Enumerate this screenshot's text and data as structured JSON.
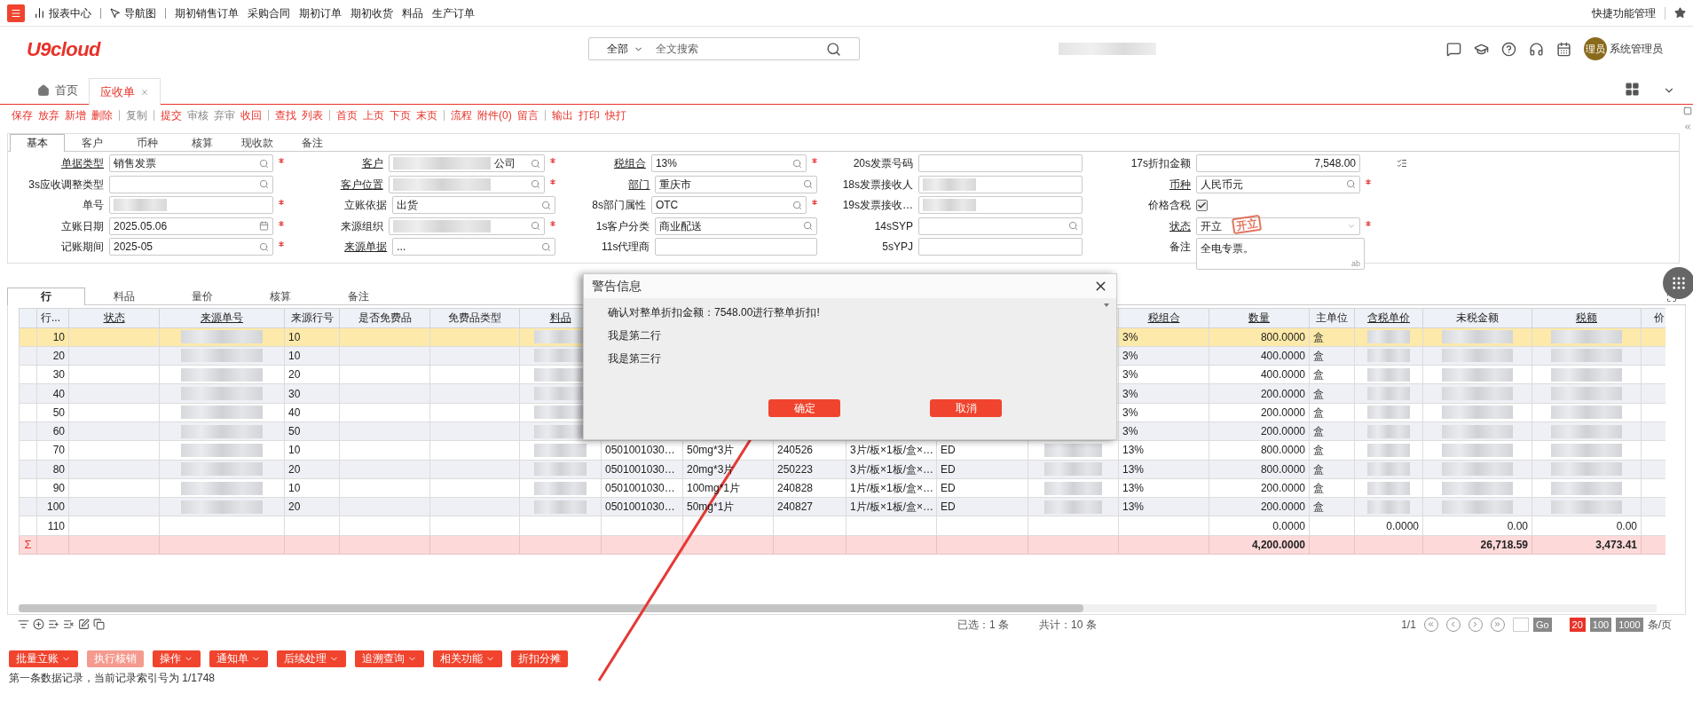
{
  "top_nav": {
    "items": [
      {
        "label": "报表中心",
        "kind": "chart"
      },
      {
        "label": "导航图",
        "kind": "nav"
      },
      {
        "label": "期初销售订单",
        "kind": "plain"
      },
      {
        "label": "采购合同",
        "kind": "plain"
      },
      {
        "label": "期初订单",
        "kind": "plain"
      },
      {
        "label": "期初收货",
        "kind": "plain"
      },
      {
        "label": "料品",
        "kind": "plain"
      },
      {
        "label": "生产订单",
        "kind": "plain"
      }
    ],
    "quick": "快捷功能管理"
  },
  "header": {
    "logo": "U9cloud",
    "search": {
      "scope": "全部",
      "placeholder": "全文搜索"
    },
    "user": {
      "avatar": "理员",
      "name": "系统管理员"
    }
  },
  "page_tabs": [
    {
      "label": "首页",
      "kind": "home",
      "selected": false
    },
    {
      "label": "应收单",
      "kind": "closable",
      "selected": true
    }
  ],
  "toolbar": [
    [
      {
        "label": "保存",
        "disabled": false
      },
      {
        "label": "放弃",
        "disabled": false
      },
      {
        "label": "新增",
        "disabled": false
      },
      {
        "label": "删除",
        "disabled": false
      }
    ],
    [
      {
        "label": "复制",
        "disabled": true
      }
    ],
    [
      {
        "label": "提交",
        "disabled": false
      },
      {
        "label": "审核",
        "disabled": true
      },
      {
        "label": "弃审",
        "disabled": true
      },
      {
        "label": "收回",
        "disabled": false
      }
    ],
    [
      {
        "label": "查找",
        "disabled": false
      },
      {
        "label": "列表",
        "disabled": false
      }
    ],
    [
      {
        "label": "首页",
        "disabled": false
      },
      {
        "label": "上页",
        "disabled": false
      },
      {
        "label": "下页",
        "disabled": false
      },
      {
        "label": "末页",
        "disabled": false
      }
    ],
    [
      {
        "label": "流程",
        "disabled": false
      },
      {
        "label": "附件(0)",
        "disabled": false
      },
      {
        "label": "留言",
        "disabled": false
      }
    ],
    [
      {
        "label": "输出",
        "disabled": false
      },
      {
        "label": "打印",
        "disabled": false
      },
      {
        "label": "快打",
        "disabled": false
      }
    ]
  ],
  "form": {
    "tabs": [
      {
        "label": "基本",
        "selected": true
      },
      {
        "label": "客户",
        "selected": false
      },
      {
        "label": "币种",
        "selected": false
      },
      {
        "label": "核算",
        "selected": false
      },
      {
        "label": "现收款",
        "selected": false
      },
      {
        "label": "备注",
        "selected": false
      }
    ],
    "rows": [
      [
        {
          "label": "单据类型",
          "underlined": true,
          "required": true,
          "kind": "lookup",
          "value": "销售发票"
        },
        {
          "label": "客户",
          "underlined": true,
          "required": true,
          "kind": "lookup",
          "value": "公司",
          "blurred": true
        },
        {
          "label": "税组合",
          "underlined": true,
          "required": true,
          "kind": "lookup",
          "value": "13%"
        },
        {
          "label": "20s发票号码",
          "underlined": false,
          "required": false,
          "kind": "text"
        },
        {
          "label": "17s折扣金额",
          "underlined": false,
          "required": false,
          "kind": "amount",
          "value": "7,548.00"
        }
      ],
      [
        {
          "label": "3s应收调整类型",
          "underlined": false,
          "required": false,
          "kind": "lookup"
        },
        {
          "label": "客户位置",
          "underlined": true,
          "required": true,
          "kind": "lookup",
          "blurred": true
        },
        {
          "label": "部门",
          "underlined": true,
          "required": false,
          "kind": "lookup",
          "value": "重庆市"
        },
        {
          "label": "18s发票接收人",
          "underlined": false,
          "required": false,
          "kind": "text",
          "blurred": true
        },
        {
          "label": "币种",
          "underlined": true,
          "required": true,
          "kind": "lookup",
          "value": "人民币元"
        }
      ],
      [
        {
          "label": "单号",
          "underlined": false,
          "required": true,
          "kind": "text",
          "blurred": true
        },
        {
          "label": "立账依据",
          "underlined": false,
          "required": false,
          "kind": "lookup",
          "value": "出货"
        },
        {
          "label": "8s部门属性",
          "underlined": false,
          "required": true,
          "kind": "lookup",
          "value": "OTC"
        },
        {
          "label": "19s发票接收…",
          "underlined": false,
          "required": false,
          "kind": "text",
          "blurred": true
        },
        {
          "label": "价格含税",
          "underlined": false,
          "required": false,
          "kind": "checkbox",
          "checked": true
        }
      ],
      [
        {
          "label": "立账日期",
          "underlined": false,
          "required": true,
          "kind": "date",
          "value": "2025.05.06"
        },
        {
          "label": "来源组织",
          "underlined": false,
          "required": true,
          "kind": "lookup",
          "blurred": true
        },
        {
          "label": "1s客户分类",
          "underlined": false,
          "required": false,
          "kind": "lookup",
          "value": "商业配送"
        },
        {
          "label": "14sSYP",
          "underlined": false,
          "required": false,
          "kind": "lookup"
        },
        {
          "label": "状态",
          "underlined": true,
          "required": true,
          "kind": "status",
          "value": "开立",
          "stamp": "开立"
        }
      ],
      [
        {
          "label": "记账期间",
          "underlined": false,
          "required": true,
          "kind": "lookup",
          "value": "2025-05"
        },
        {
          "label": "来源单据",
          "underlined": true,
          "required": false,
          "kind": "lookup",
          "value": "..."
        },
        {
          "label": "11s代理商",
          "underlined": false,
          "required": false,
          "kind": "text"
        },
        {
          "label": "5sYPJ",
          "underlined": false,
          "required": false,
          "kind": "text"
        },
        {
          "label": "备注",
          "underlined": false,
          "required": false,
          "kind": "textarea",
          "value": "全电专票。",
          "hint": "ab"
        }
      ]
    ]
  },
  "grid": {
    "tabs": [
      {
        "label": "行",
        "selected": true
      },
      {
        "label": "料品",
        "selected": false
      },
      {
        "label": "量价",
        "selected": false
      },
      {
        "label": "核算",
        "selected": false
      },
      {
        "label": "备注",
        "selected": false
      }
    ],
    "columns_left": [
      {
        "label": "行...",
        "underlined": false
      },
      {
        "label": "状态",
        "underlined": true
      },
      {
        "label": "来源单号",
        "underlined": true
      },
      {
        "label": "来源行号",
        "underlined": false
      },
      {
        "label": "是否免费品",
        "underlined": false
      },
      {
        "label": "免费品类型",
        "underlined": false
      },
      {
        "label": "料品",
        "underlined": true
      }
    ],
    "columns_right": [
      {
        "label": "税组合",
        "underlined": true
      },
      {
        "label": "数量",
        "underlined": true
      },
      {
        "label": "主单位",
        "underlined": false
      },
      {
        "label": "含税单价",
        "underlined": true
      },
      {
        "label": "未税金额",
        "underlined": false
      },
      {
        "label": "税额",
        "underlined": true
      },
      {
        "label": "价",
        "underlined": false
      }
    ],
    "rows": [
      {
        "selected": true,
        "redacted": true,
        "line": "10",
        "source_line": "10",
        "tax_group": "3%",
        "quantity": "800.0000",
        "unit": "盒"
      },
      {
        "selected": false,
        "redacted": true,
        "line": "20",
        "source_line": "10",
        "tax_group": "3%",
        "quantity": "400.0000",
        "unit": "盒"
      },
      {
        "selected": false,
        "redacted": true,
        "line": "30",
        "source_line": "20",
        "tax_group": "3%",
        "quantity": "400.0000",
        "unit": "盒"
      },
      {
        "selected": false,
        "redacted": true,
        "line": "40",
        "source_line": "30",
        "tax_group": "3%",
        "quantity": "200.0000",
        "unit": "盒"
      },
      {
        "selected": false,
        "redacted": true,
        "line": "50",
        "source_line": "40",
        "tax_group": "3%",
        "quantity": "200.0000",
        "unit": "盒"
      },
      {
        "selected": false,
        "redacted": true,
        "line": "60",
        "source_line": "50",
        "tax_group": "3%",
        "quantity": "200.0000",
        "unit": "盒"
      },
      {
        "selected": false,
        "redacted": true,
        "line": "70",
        "source_line": "10",
        "column_8": "0501001030…",
        "column_9": "50mg*3片",
        "column_10": "240526",
        "column_11": "3片/板×1板/盒×…",
        "column_12": "ED",
        "tax_group": "13%",
        "quantity": "800.0000",
        "unit": "盒"
      },
      {
        "selected": false,
        "redacted": true,
        "line": "80",
        "source_line": "20",
        "column_8": "0501001030…",
        "column_9": "20mg*3片",
        "column_10": "250223",
        "column_11": "3片/板×1板/盒×…",
        "column_12": "ED",
        "tax_group": "13%",
        "quantity": "800.0000",
        "unit": "盒"
      },
      {
        "selected": false,
        "redacted": true,
        "line": "90",
        "source_line": "10",
        "column_8": "0501001030…",
        "column_9": "100mg*1片",
        "column_10": "240828",
        "column_11": "1片/板×1板/盒×…",
        "column_12": "ED",
        "tax_group": "13%",
        "quantity": "200.0000",
        "unit": "盒"
      },
      {
        "selected": false,
        "redacted": true,
        "line": "100",
        "source_line": "20",
        "column_8": "0501001030…",
        "column_9": "50mg*1片",
        "column_10": "240827",
        "column_11": "1片/板×1板/盒×…",
        "column_12": "ED",
        "tax_group": "13%",
        "quantity": "200.0000",
        "unit": "盒"
      },
      {
        "selected": false,
        "redacted": false,
        "line": "110",
        "quantity": "0.0000",
        "unit_price": "0.0000",
        "net_amount": "0.00",
        "tax_amount": "0.00"
      }
    ],
    "sum_mark": "Σ",
    "totals": {
      "quantity": "4,200.0000",
      "net_amount": "26,718.59",
      "tax_amount": "3,473.41"
    }
  },
  "footer": {
    "selected": "已选：1 条",
    "total": "共计：10 条",
    "page": "1/1",
    "go": "Go",
    "page_sizes": [
      {
        "label": "20",
        "selected": true
      },
      {
        "label": "100",
        "selected": false
      },
      {
        "label": "1000",
        "selected": false
      }
    ],
    "unit": "条/页"
  },
  "actions": [
    {
      "label": "批量立账",
      "menu": true,
      "disabled": false
    },
    {
      "label": "执行核销",
      "menu": false,
      "disabled": true
    },
    {
      "label": "操作",
      "menu": true,
      "disabled": false
    },
    {
      "label": "通知单",
      "menu": true,
      "disabled": false
    },
    {
      "label": "后续处理",
      "menu": true,
      "disabled": false
    },
    {
      "label": "追溯查询",
      "menu": true,
      "disabled": false
    },
    {
      "label": "相关功能",
      "menu": true,
      "disabled": false
    },
    {
      "label": "折扣分摊",
      "menu": false,
      "disabled": false
    }
  ],
  "status_bar": "第一条数据记录，当前记录索引号为 1/1748",
  "dialog": {
    "title": "警告信息",
    "lines": [
      "确认对整单折扣金额：7548.00进行整单折扣!",
      "我是第二行",
      "我是第三行"
    ],
    "buttons": [
      "确定",
      "取消"
    ]
  }
}
